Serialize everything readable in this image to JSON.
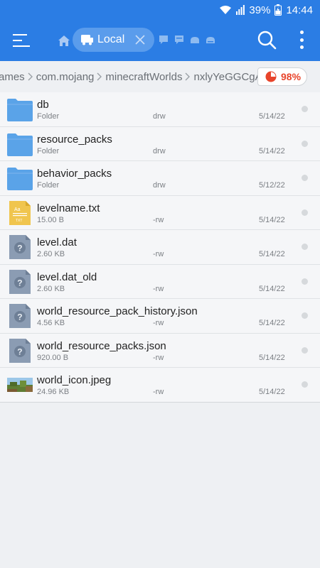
{
  "status_bar": {
    "battery": "39%",
    "time": "14:44"
  },
  "app_bar": {
    "active_tab_label": "Local"
  },
  "breadcrumb": {
    "items": [
      "ames",
      "com.mojang",
      "minecraftWorlds",
      "nxlyYeGGCgA="
    ],
    "storage_percent": "98%"
  },
  "files": [
    {
      "name": "db",
      "meta": "Folder",
      "perm": "drw",
      "date": "5/14/22",
      "icon": "folder-icon"
    },
    {
      "name": "resource_packs",
      "meta": "Folder",
      "perm": "drw",
      "date": "5/14/22",
      "icon": "folder-icon"
    },
    {
      "name": "behavior_packs",
      "meta": "Folder",
      "perm": "drw",
      "date": "5/12/22",
      "icon": "folder-icon"
    },
    {
      "name": "levelname.txt",
      "meta": "15.00 B",
      "perm": "-rw",
      "date": "5/14/22",
      "icon": "text-file-icon"
    },
    {
      "name": "level.dat",
      "meta": "2.60 KB",
      "perm": "-rw",
      "date": "5/14/22",
      "icon": "unknown-file-icon"
    },
    {
      "name": "level.dat_old",
      "meta": "2.60 KB",
      "perm": "-rw",
      "date": "5/14/22",
      "icon": "unknown-file-icon"
    },
    {
      "name": "world_resource_pack_history.json",
      "meta": "4.56 KB",
      "perm": "-rw",
      "date": "5/14/22",
      "icon": "unknown-file-icon"
    },
    {
      "name": "world_resource_packs.json",
      "meta": "920.00 B",
      "perm": "-rw",
      "date": "5/14/22",
      "icon": "unknown-file-icon"
    },
    {
      "name": "world_icon.jpeg",
      "meta": "24.96 KB",
      "perm": "-rw",
      "date": "5/14/22",
      "icon": "image-thumbnail-icon"
    }
  ],
  "colors": {
    "primary": "#2b7de4",
    "storage_warning": "#e8442b",
    "folder": "#5aa3e8"
  }
}
